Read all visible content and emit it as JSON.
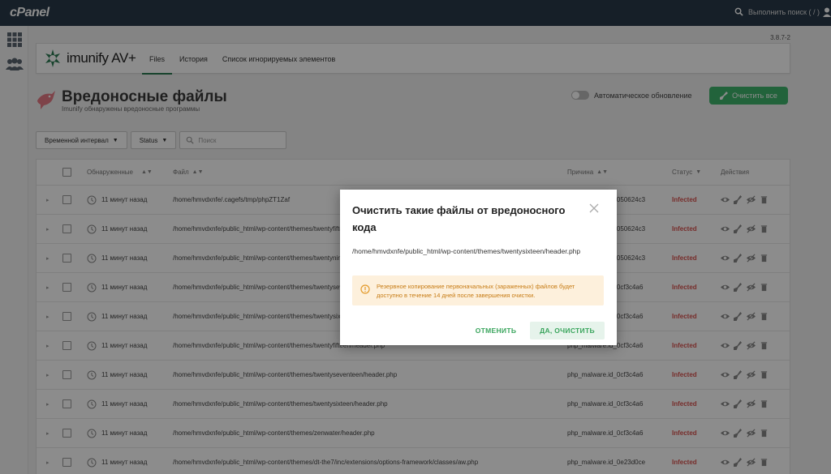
{
  "topbar": {
    "logo": "cPanel",
    "search_placeholder": "Выполнить поиск ( / )"
  },
  "version": "3.8.7-2",
  "header": {
    "brand": "imunify AV+",
    "tabs": [
      {
        "label": "Files",
        "active": true
      },
      {
        "label": "История",
        "active": false
      },
      {
        "label": "Список игнорируемых элементов",
        "active": false
      }
    ]
  },
  "page": {
    "title": "Вредоносные файлы",
    "subtitle": "Imunify обнаружены вредоносные программы",
    "auto_update_label": "Автоматическое обновление",
    "clean_all_label": "Очистить все"
  },
  "filters": {
    "time_interval": "Временной интервал",
    "status": "Status",
    "search_placeholder": "Поиск"
  },
  "table": {
    "columns": {
      "detected": "Обнаруженные",
      "file": "Файл",
      "reason": "Причина",
      "status": "Статус",
      "actions": "Действия"
    },
    "rows": [
      {
        "time": "11 минут назад",
        "file": "/home/hmvdxnfe/.cagefs/tmp/phpZT1Zaf",
        "reason": "php_malware.id_050624c3",
        "status": "Infected"
      },
      {
        "time": "11 минут назад",
        "file": "/home/hmvdxnfe/public_html/wp-content/themes/twentyfifteen/header.php",
        "reason": "php_malware.id_050624c3",
        "status": "Infected"
      },
      {
        "time": "11 минут назад",
        "file": "/home/hmvdxnfe/public_html/wp-content/themes/twentynineteen/header.php",
        "reason": "php_malware.id_050624c3",
        "status": "Infected"
      },
      {
        "time": "11 минут назад",
        "file": "/home/hmvdxnfe/public_html/wp-content/themes/twentyseventeen/header.php",
        "reason": "php_malware.id_0cf3c4a6",
        "status": "Infected"
      },
      {
        "time": "11 минут назад",
        "file": "/home/hmvdxnfe/public_html/wp-content/themes/twentysixteen/header.php",
        "reason": "php_malware.id_0cf3c4a6",
        "status": "Infected"
      },
      {
        "time": "11 минут назад",
        "file": "/home/hmvdxnfe/public_html/wp-content/themes/twentyfifteen/header.php",
        "reason": "php_malware.id_0cf3c4a6",
        "status": "Infected"
      },
      {
        "time": "11 минут назад",
        "file": "/home/hmvdxnfe/public_html/wp-content/themes/twentyseventeen/header.php",
        "reason": "php_malware.id_0cf3c4a6",
        "status": "Infected"
      },
      {
        "time": "11 минут назад",
        "file": "/home/hmvdxnfe/public_html/wp-content/themes/twentysixteen/header.php",
        "reason": "php_malware.id_0cf3c4a6",
        "status": "Infected"
      },
      {
        "time": "11 минут назад",
        "file": "/home/hmvdxnfe/public_html/wp-content/themes/zenwater/header.php",
        "reason": "php_malware.id_0cf3c4a6",
        "status": "Infected"
      },
      {
        "time": "11 минут назад",
        "file": "/home/hmvdxnfe/public_html/wp-content/themes/dt-the7/inc/extensions/options-framework/classes/aw.php",
        "reason": "php_malware.id_0e23d0ce",
        "status": "Infected"
      }
    ]
  },
  "modal": {
    "title": "Очистить такие файлы от вредоносного кода",
    "path": "/home/hmvdxnfe/public_html/wp-content/themes/twentysixteen/header.php",
    "notice": "Резервное копирование первоначальных (зараженных) файлов будет доступно в течение 14 дней после завершения очистки.",
    "cancel_label": "ОТМЕНИТЬ",
    "confirm_label": "ДА, ОЧИСТИТЬ"
  },
  "colors": {
    "topbar": "#293a4a",
    "accent_green": "#3fb56c",
    "infected_red": "#d9534f",
    "notice_bg": "#fdf0dc",
    "notice_text": "#c77c15"
  }
}
